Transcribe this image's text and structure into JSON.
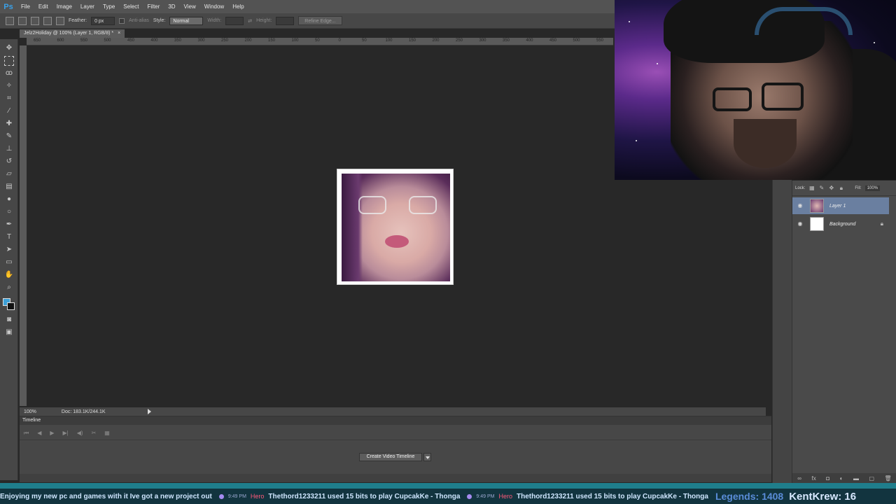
{
  "app": {
    "logo": "Ps"
  },
  "menu": [
    "File",
    "Edit",
    "Image",
    "Layer",
    "Type",
    "Select",
    "Filter",
    "3D",
    "View",
    "Window",
    "Help"
  ],
  "options": {
    "feather_label": "Feather:",
    "feather_value": "0 px",
    "antialias_label": "Anti-alias",
    "style_label": "Style:",
    "style_value": "Normal",
    "width_label": "Width:",
    "height_label": "Height:",
    "refine_edge_label": "Refine Edge..."
  },
  "document": {
    "tab_title": "Jelz2Holiday @ 100% (Layer 1, RGB/8) *",
    "close_glyph": "×"
  },
  "ruler": {
    "h_ticks": [
      "650",
      "600",
      "550",
      "500",
      "450",
      "400",
      "350",
      "300",
      "250",
      "200",
      "150",
      "100",
      "50",
      "0",
      "50",
      "100",
      "150",
      "200",
      "250",
      "300",
      "350",
      "400",
      "450",
      "500",
      "550"
    ]
  },
  "status": {
    "zoom": "100%",
    "doc_info": "Doc: 183.1K/244.1K"
  },
  "timeline": {
    "tab_label": "Timeline",
    "create_button": "Create Video Timeline",
    "controls": [
      "⏮",
      "◀",
      "▶",
      "▶|",
      "◀)",
      "✂",
      "▦"
    ]
  },
  "layers": {
    "lock_label": "Lock:",
    "fill_label": "Fill:",
    "fill_value": "100%",
    "items": [
      {
        "name": "Layer 1",
        "selected": true,
        "locked": false
      },
      {
        "name": "Background",
        "selected": false,
        "locked": true
      }
    ]
  },
  "ticker": {
    "lead_text": "Enjoying my new pc and games with it  Ive got a new project out",
    "time1": "9:49 PM",
    "user1": "Hero",
    "msg1": "Thethord1233211 used 15 bits to play CupcakKe - Thonga",
    "time2": "9:49 PM",
    "user2": "Hero",
    "msg2": "Thethord1233211 used 15 bits to play CupcakKe - Thonga",
    "legends": "Legends: 1408",
    "krew": "KentKrew: 16"
  },
  "colors": {
    "foreground": "#3ca0d8",
    "background": "#111111",
    "accent": "#3aa0e8"
  }
}
